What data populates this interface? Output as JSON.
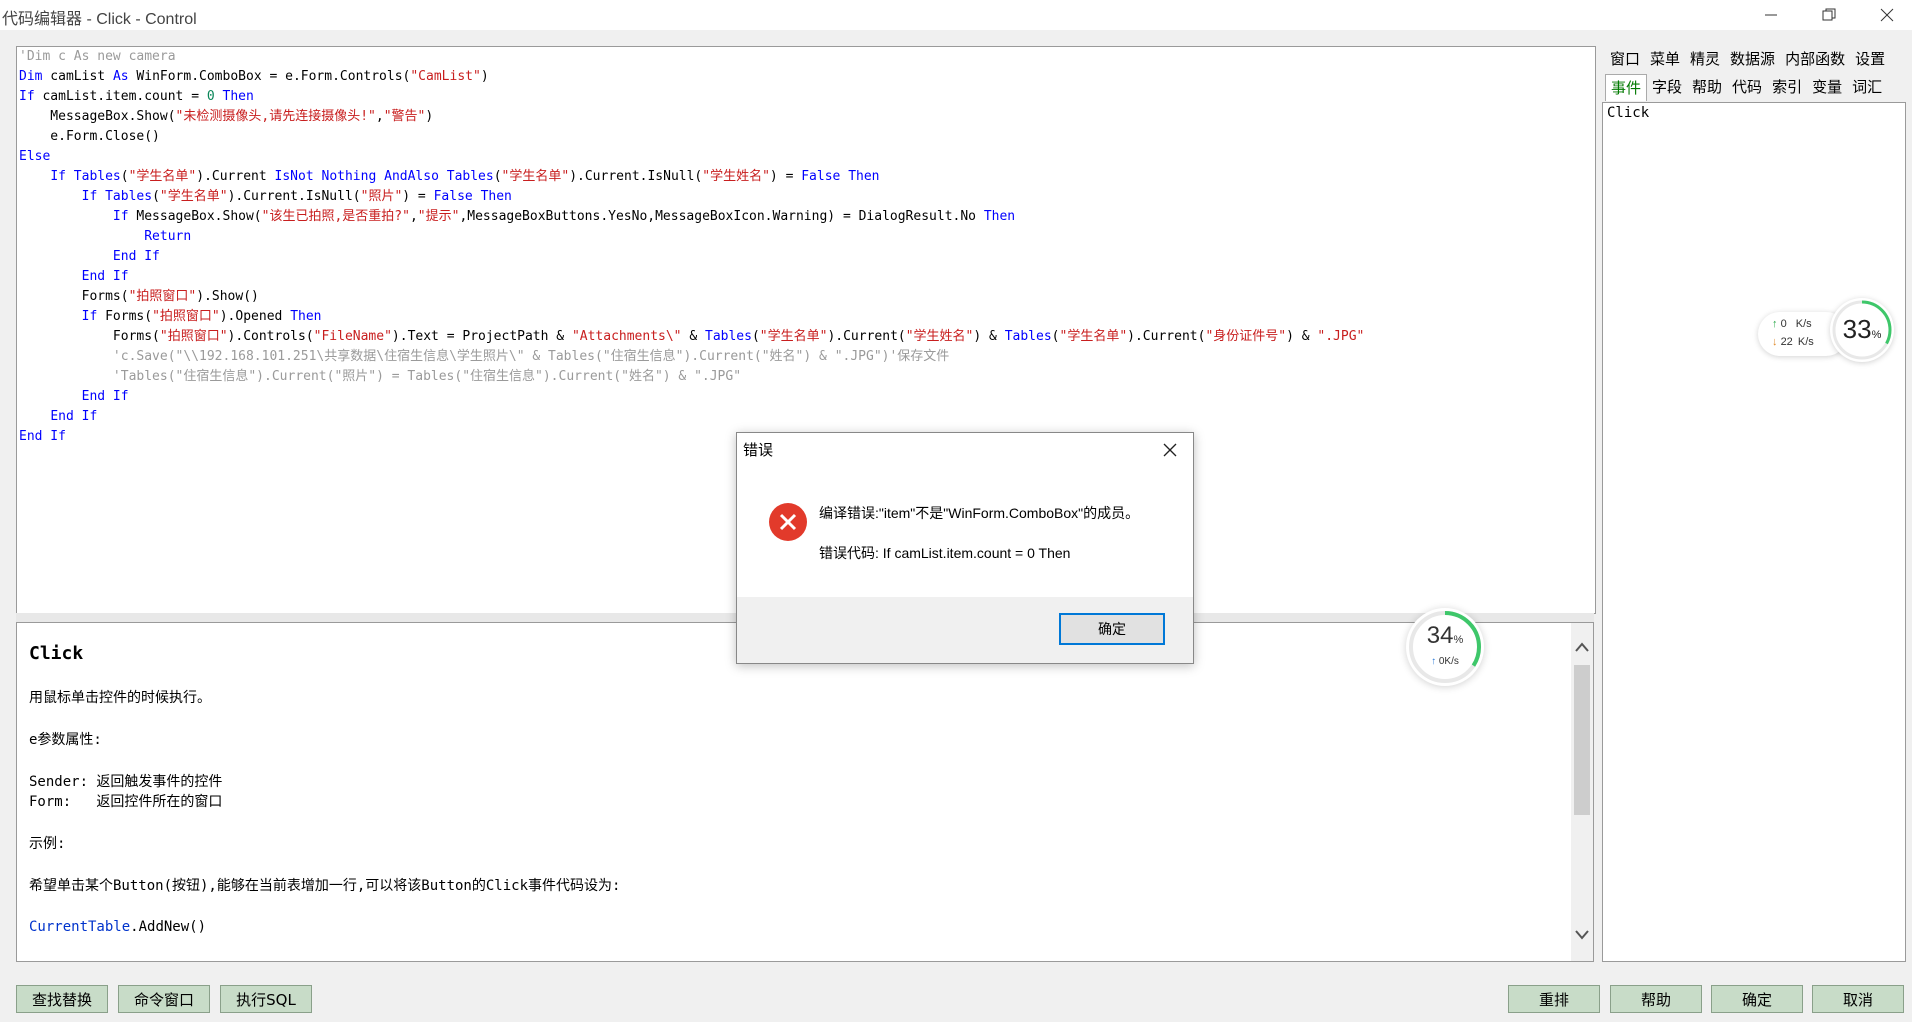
{
  "window": {
    "title": "代码编辑器 - Click - Control",
    "minimize_icon": "minimize-icon",
    "maximize_icon": "restore-icon",
    "close_icon": "close-icon"
  },
  "editor": {
    "lines": [
      [
        {
          "t": "'Dim c As new camera",
          "c": "cmt"
        }
      ],
      [
        {
          "t": "Dim",
          "c": "kw"
        },
        {
          "t": " camList "
        },
        {
          "t": "As",
          "c": "kw"
        },
        {
          "t": " WinForm.ComboBox = e.Form.Controls("
        },
        {
          "t": "\"CamList\"",
          "c": "str"
        },
        {
          "t": ")"
        }
      ],
      [
        {
          "t": "If",
          "c": "kw"
        },
        {
          "t": " camList.item.count = "
        },
        {
          "t": "0",
          "c": "num"
        },
        {
          "t": " "
        },
        {
          "t": "Then",
          "c": "kw"
        }
      ],
      [
        {
          "t": "    MessageBox.Show("
        },
        {
          "t": "\"未检测摄像头,请先连接摄像头!\"",
          "c": "str"
        },
        {
          "t": ","
        },
        {
          "t": "\"警告\"",
          "c": "str"
        },
        {
          "t": ")"
        }
      ],
      [
        {
          "t": "    e.Form.Close()"
        }
      ],
      [
        {
          "t": "Else",
          "c": "kw"
        }
      ],
      [
        {
          "t": "    "
        },
        {
          "t": "If",
          "c": "kw"
        },
        {
          "t": " "
        },
        {
          "t": "Tables",
          "c": "kw"
        },
        {
          "t": "("
        },
        {
          "t": "\"学生名单\"",
          "c": "str"
        },
        {
          "t": ").Current "
        },
        {
          "t": "IsNot",
          "c": "kw"
        },
        {
          "t": " "
        },
        {
          "t": "Nothing",
          "c": "kw"
        },
        {
          "t": " "
        },
        {
          "t": "AndAlso",
          "c": "kw"
        },
        {
          "t": " "
        },
        {
          "t": "Tables",
          "c": "kw"
        },
        {
          "t": "("
        },
        {
          "t": "\"学生名单\"",
          "c": "str"
        },
        {
          "t": ").Current.IsNull("
        },
        {
          "t": "\"学生姓名\"",
          "c": "str"
        },
        {
          "t": ") = "
        },
        {
          "t": "False",
          "c": "kw"
        },
        {
          "t": " "
        },
        {
          "t": "Then",
          "c": "kw"
        }
      ],
      [
        {
          "t": "        "
        },
        {
          "t": "If",
          "c": "kw"
        },
        {
          "t": " "
        },
        {
          "t": "Tables",
          "c": "kw"
        },
        {
          "t": "("
        },
        {
          "t": "\"学生名单\"",
          "c": "str"
        },
        {
          "t": ").Current.IsNull("
        },
        {
          "t": "\"照片\"",
          "c": "str"
        },
        {
          "t": ") = "
        },
        {
          "t": "False",
          "c": "kw"
        },
        {
          "t": " "
        },
        {
          "t": "Then",
          "c": "kw"
        }
      ],
      [
        {
          "t": "            "
        },
        {
          "t": "If",
          "c": "kw"
        },
        {
          "t": " MessageBox.Show("
        },
        {
          "t": "\"该生已拍照,是否重拍?\"",
          "c": "str"
        },
        {
          "t": ","
        },
        {
          "t": "\"提示\"",
          "c": "str"
        },
        {
          "t": ",MessageBoxButtons.YesNo,MessageBoxIcon.Warning) = DialogResult.No "
        },
        {
          "t": "Then",
          "c": "kw"
        }
      ],
      [
        {
          "t": "                "
        },
        {
          "t": "Return",
          "c": "kw"
        }
      ],
      [
        {
          "t": "            "
        },
        {
          "t": "End If",
          "c": "kw"
        }
      ],
      [
        {
          "t": "        "
        },
        {
          "t": "End If",
          "c": "kw"
        }
      ],
      [
        {
          "t": "        Forms("
        },
        {
          "t": "\"拍照窗口\"",
          "c": "str"
        },
        {
          "t": ").Show()"
        }
      ],
      [
        {
          "t": "        "
        },
        {
          "t": "If",
          "c": "kw"
        },
        {
          "t": " Forms("
        },
        {
          "t": "\"拍照窗口\"",
          "c": "str"
        },
        {
          "t": ").Opened "
        },
        {
          "t": "Then",
          "c": "kw"
        }
      ],
      [
        {
          "t": "            Forms("
        },
        {
          "t": "\"拍照窗口\"",
          "c": "str"
        },
        {
          "t": ").Controls("
        },
        {
          "t": "\"FileName\"",
          "c": "str"
        },
        {
          "t": ").Text = ProjectPath & "
        },
        {
          "t": "\"Attachments\\\"",
          "c": "str"
        },
        {
          "t": " & "
        },
        {
          "t": "Tables",
          "c": "kw"
        },
        {
          "t": "("
        },
        {
          "t": "\"学生名单\"",
          "c": "str"
        },
        {
          "t": ").Current("
        },
        {
          "t": "\"学生姓名\"",
          "c": "str"
        },
        {
          "t": ") & "
        },
        {
          "t": "Tables",
          "c": "kw"
        },
        {
          "t": "("
        },
        {
          "t": "\"学生名单\"",
          "c": "str"
        },
        {
          "t": ").Current("
        },
        {
          "t": "\"身份证件号\"",
          "c": "str"
        },
        {
          "t": ") & "
        },
        {
          "t": "\".JPG\"",
          "c": "str"
        }
      ],
      [
        {
          "t": "            'c.Save(\"\\\\192.168.101.251\\共享数据\\住宿生信息\\学生照片\\\" & Tables(\"住宿生信息\").Current(\"姓名\") & \".JPG\")'保存文件",
          "c": "cmt"
        }
      ],
      [
        {
          "t": "            'Tables(\"住宿生信息\").Current(\"照片\") = Tables(\"住宿生信息\").Current(\"姓名\") & \".JPG\"",
          "c": "cmt"
        }
      ],
      [
        {
          "t": "        "
        },
        {
          "t": "End If",
          "c": "kw"
        }
      ],
      [
        {
          "t": "    "
        },
        {
          "t": "End If",
          "c": "kw"
        }
      ],
      [
        {
          "t": "End If",
          "c": "kw"
        }
      ]
    ]
  },
  "help": {
    "heading": "Click",
    "desc": "用鼠标单击控件的时候执行。",
    "params_title": "e参数属性:",
    "param_sender": "Sender: 返回触发事件的控件",
    "param_form": "Form:   返回控件所在的窗口",
    "example_title": "示例:",
    "example_desc": "希望单击某个Button(按钮),能够在当前表增加一行,可以将该Button的Click事件代码设为:",
    "example_code_obj": "CurrentTable",
    "example_code_rest": ".AddNew()",
    "scroll_up_icon": "chevron-up-icon",
    "scroll_down_icon": "chevron-down-icon"
  },
  "side": {
    "row1": [
      "窗口",
      "菜单",
      "精灵",
      "数据源",
      "内部函数",
      "设置"
    ],
    "row2": [
      "事件",
      "字段",
      "帮助",
      "代码",
      "索引",
      "变量",
      "词汇"
    ],
    "active_tab": "事件",
    "list": [
      "Click"
    ]
  },
  "net_widget": {
    "up": "0",
    "up_unit": "K/s",
    "down": "22",
    "down_unit": "K/s",
    "percent": "33",
    "pct_sign": "%"
  },
  "cpu_widget": {
    "percent": "34",
    "pct_sign": "%",
    "speed": "0K/s"
  },
  "buttons": {
    "find_replace": "查找替换",
    "command_window": "命令窗口",
    "exec_sql": "执行SQL",
    "rearrange": "重排",
    "help": "帮助",
    "ok": "确定",
    "cancel": "取消"
  },
  "dialog": {
    "title": "错误",
    "message": "编译错误:\"item\"不是\"WinForm.ComboBox\"的成员。",
    "code_line": "错误代码:  If camList.item.count = 0 Then",
    "ok_label": "确定",
    "icon": "error-icon",
    "close_icon": "close-icon"
  },
  "colors": {
    "keyword": "#0000ff",
    "string": "#c81e1e",
    "comment": "#9a9a9a",
    "button_bg": "#c8dcc8",
    "active_tab": "#007a00",
    "error_red": "#e23a2b"
  }
}
